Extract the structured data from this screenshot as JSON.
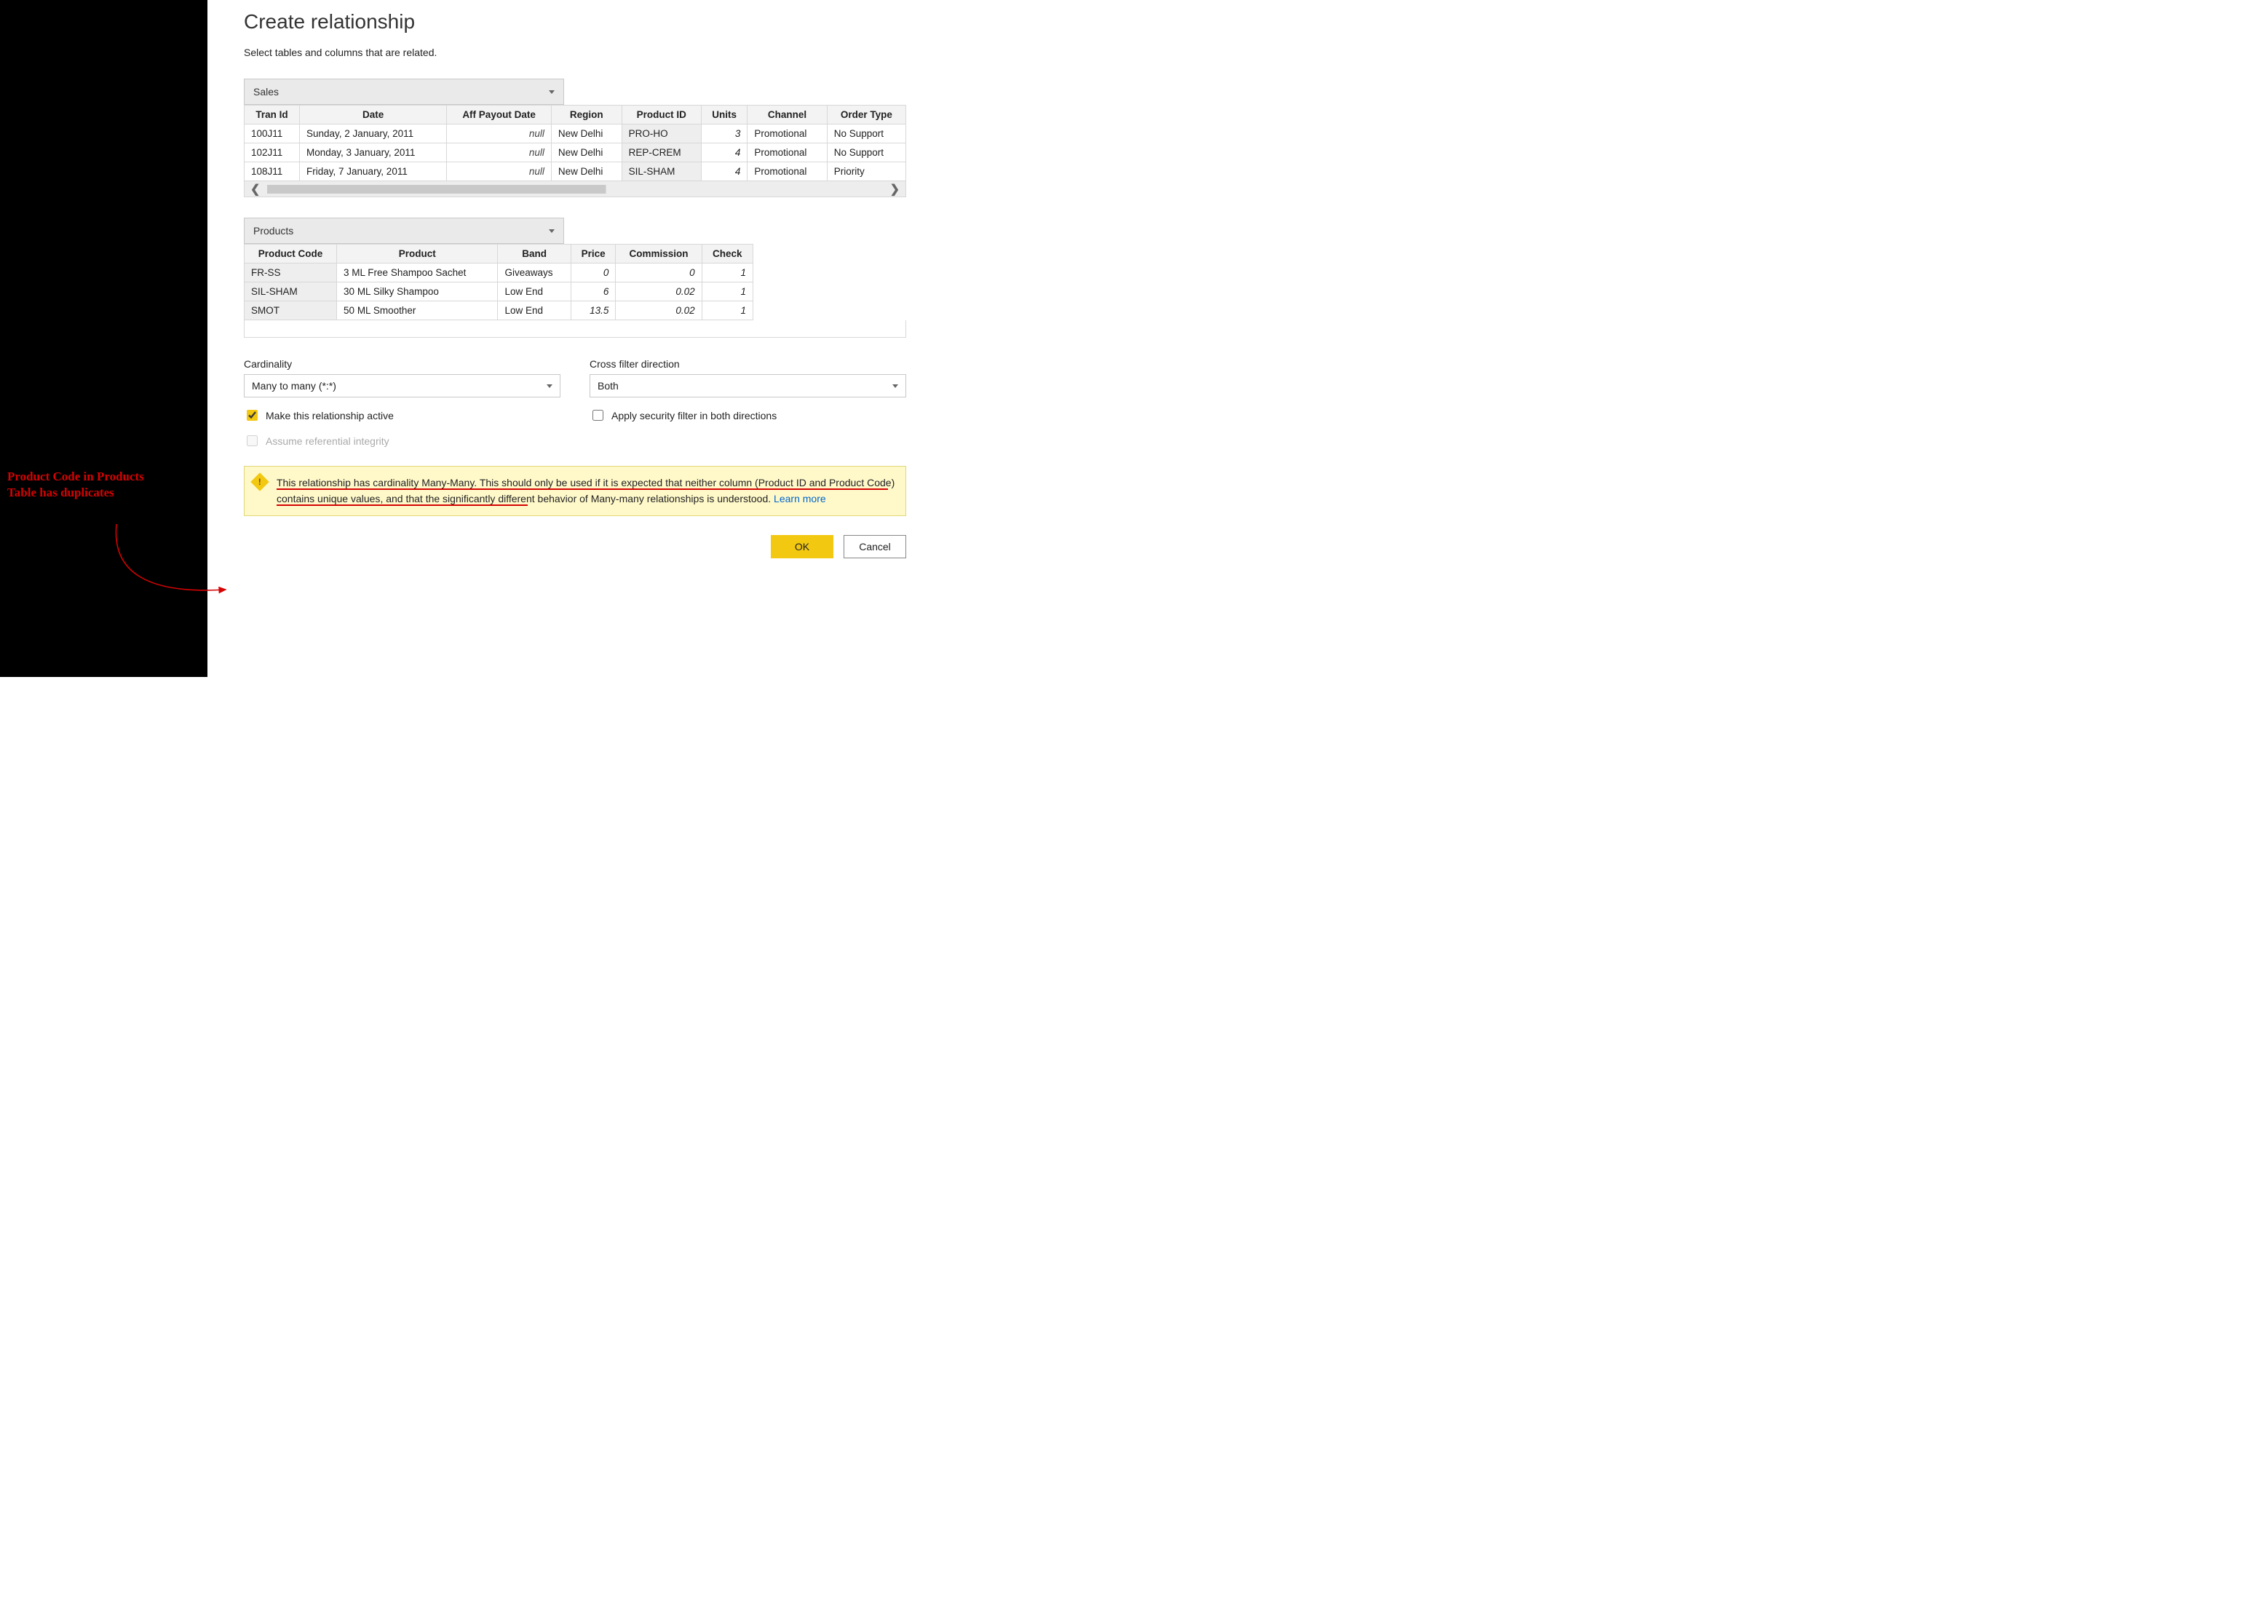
{
  "annotation": {
    "line1_a": "Product Code",
    "line1_b": " in Products",
    "line2_a": "Table has ",
    "line2_b": "duplicates"
  },
  "dialog": {
    "title": "Create relationship",
    "subtext": "Select tables and columns that are related."
  },
  "table1": {
    "select_label": "Sales",
    "headers": [
      "Tran Id",
      "Date",
      "Aff Payout Date",
      "Region",
      "Product ID",
      "Units",
      "Channel",
      "Order Type"
    ],
    "rows": [
      {
        "tran": "100J11",
        "date": "Sunday, 2 January, 2011",
        "payout": "null",
        "region": "New Delhi",
        "pid": "PRO-HO",
        "units": "3",
        "channel": "Promotional",
        "otype": "No Support"
      },
      {
        "tran": "102J11",
        "date": "Monday, 3 January, 2011",
        "payout": "null",
        "region": "New Delhi",
        "pid": "REP-CREM",
        "units": "4",
        "channel": "Promotional",
        "otype": "No Support"
      },
      {
        "tran": "108J11",
        "date": "Friday, 7 January, 2011",
        "payout": "null",
        "region": "New Delhi",
        "pid": "SIL-SHAM",
        "units": "4",
        "channel": "Promotional",
        "otype": "Priority"
      }
    ]
  },
  "table2": {
    "select_label": "Products",
    "headers": [
      "Product Code",
      "Product",
      "Band",
      "Price",
      "Commission",
      "Check"
    ],
    "rows": [
      {
        "code": "FR-SS",
        "prod": "3 ML Free Shampoo Sachet",
        "band": "Giveaways",
        "price": "0",
        "comm": "0",
        "check": "1"
      },
      {
        "code": "SIL-SHAM",
        "prod": "30 ML Silky Shampoo",
        "band": "Low End",
        "price": "6",
        "comm": "0.02",
        "check": "1"
      },
      {
        "code": "SMOT",
        "prod": "50 ML Smoother",
        "band": "Low End",
        "price": "13.5",
        "comm": "0.02",
        "check": "1"
      }
    ]
  },
  "options": {
    "cardinality_label": "Cardinality",
    "cardinality_value": "Many to many (*:*)",
    "cross_label": "Cross filter direction",
    "cross_value": "Both",
    "chk_active": "Make this relationship active",
    "chk_security": "Apply security filter in both directions",
    "chk_referential": "Assume referential integrity"
  },
  "warning": {
    "text_a": "This relationship has cardinality Many-Many. This should only be used if it is expected that neither column (Product ID and Product Code) contains unique values",
    "text_b": ", and that the significantly different behavior of Many-many relationships is understood.  ",
    "learn_more": "Learn more"
  },
  "buttons": {
    "ok": "OK",
    "cancel": "Cancel"
  }
}
